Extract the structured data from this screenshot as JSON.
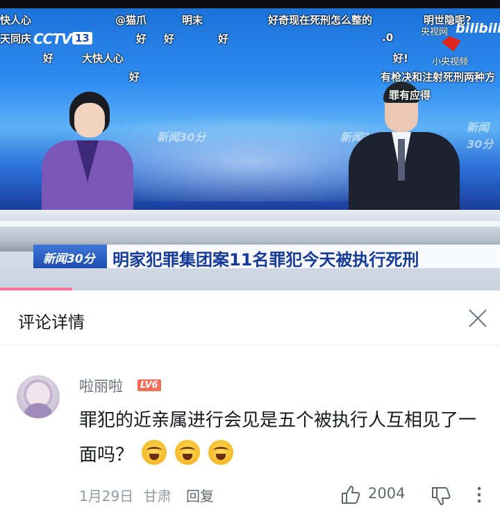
{
  "video": {
    "danmaku": [
      "快人心",
      "@猫爪",
      "明末",
      "好奇现在死刑怎么整的",
      "明世隐呢?",
      "天同庆",
      "好",
      "好",
      "好",
      ".0",
      "好",
      "大快人心",
      "好!",
      "有枪决和注射死刑两种方",
      "好",
      "罪有应得"
    ],
    "channel_logo": "CCTV",
    "channel_number": "13",
    "watermark_cctv": "央视网",
    "watermark_app": "小央视频",
    "watermark_bili": "bilibili",
    "background_show_name": "新闻30分",
    "lower_third_tag": "新闻30分",
    "lower_third_headline": "明家犯罪集团案11名罪犯今天被执行死刑",
    "progress_fraction": 0.145
  },
  "comments_panel": {
    "title": "评论详情",
    "close_icon": "close-icon"
  },
  "comment": {
    "username": "啦丽啦",
    "level": "LV6",
    "text": "罪犯的近亲属进行会见是五个被执行人互相见了一面吗？",
    "emoji_count": 3,
    "date": "1月29日",
    "location": "甘肃",
    "reply_label": "回复",
    "likes": "2004",
    "icons": [
      "thumbs-up-icon",
      "thumbs-down-icon",
      "more-vertical-icon"
    ]
  },
  "colors": {
    "accent_pink": "#fb7299",
    "headline_blue": "#163a9a",
    "level_badge": "#f26f5b"
  }
}
